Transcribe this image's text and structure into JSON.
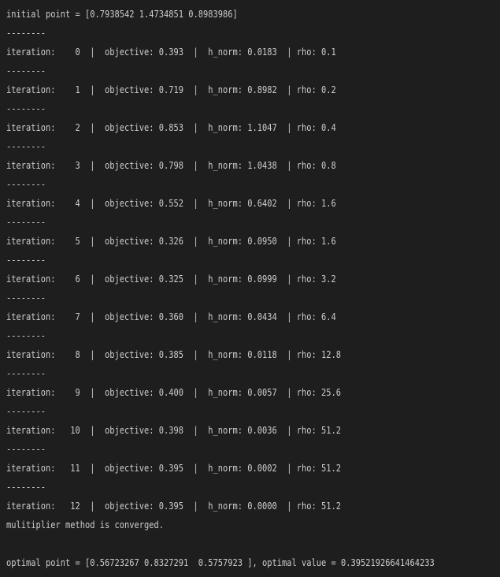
{
  "terminal": {
    "initial_point": "initial point = [0.7938542 1.4734851 0.8983986]",
    "separator": "--------",
    "iterations": [
      "iteration:    0  |  objective: 0.393  |  h_norm: 0.0183  | rho: 0.1",
      "iteration:    1  |  objective: 0.719  |  h_norm: 0.8982  | rho: 0.2",
      "iteration:    2  |  objective: 0.853  |  h_norm: 1.1047  | rho: 0.4",
      "iteration:    3  |  objective: 0.798  |  h_norm: 1.0438  | rho: 0.8",
      "iteration:    4  |  objective: 0.552  |  h_norm: 0.6402  | rho: 1.6",
      "iteration:    5  |  objective: 0.326  |  h_norm: 0.0950  | rho: 1.6",
      "iteration:    6  |  objective: 0.325  |  h_norm: 0.0999  | rho: 3.2",
      "iteration:    7  |  objective: 0.360  |  h_norm: 0.0434  | rho: 6.4",
      "iteration:    8  |  objective: 0.385  |  h_norm: 0.0118  | rho: 12.8",
      "iteration:    9  |  objective: 0.400  |  h_norm: 0.0057  | rho: 25.6",
      "iteration:   10  |  objective: 0.398  |  h_norm: 0.0036  | rho: 51.2",
      "iteration:   11  |  objective: 0.395  |  h_norm: 0.0002  | rho: 51.2",
      "iteration:   12  |  objective: 0.395  |  h_norm: 0.0000  | rho: 51.2"
    ],
    "converged": "mulitiplier method is converged.",
    "optimal": "optimal point = [0.56723267 0.8327291  0.5757923 ], optimal value = 0.39521926641464233"
  },
  "colors": {
    "background": "#1e1e1e",
    "text": "#cccccc"
  }
}
